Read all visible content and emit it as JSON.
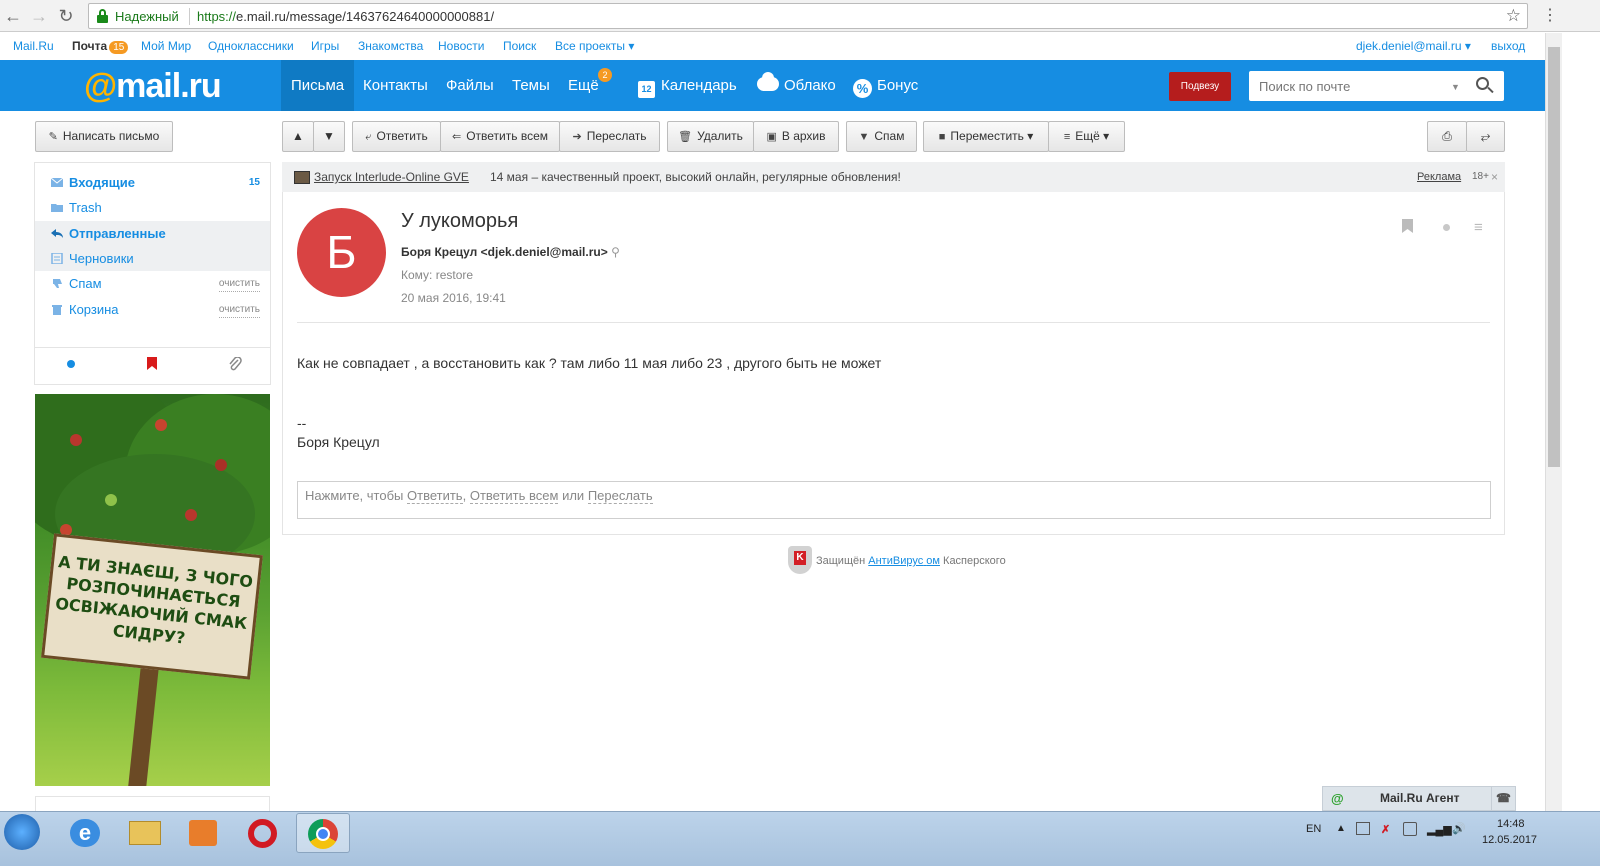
{
  "browser": {
    "secure_label": "Надежный",
    "url_proto": "https://",
    "url_rest": "e.mail.ru/message/14637624640000000881/"
  },
  "portal": {
    "links": [
      "Mail.Ru",
      "Почта",
      "Мой Мир",
      "Одноклассники",
      "Игры",
      "Знакомства",
      "Новости",
      "Поиск",
      "Все проекты ▾"
    ],
    "mail_count": "15",
    "user": "djek.deniel@mail.ru ▾",
    "logout": "выход"
  },
  "header": {
    "logo_at": "@",
    "logo_text": "mail.ru",
    "nav": [
      "Письма",
      "Контакты",
      "Файлы",
      "Темы",
      "Ещё"
    ],
    "more_badge": "2",
    "calendar_day": "12",
    "calendar": "Календарь",
    "cloud": "Облако",
    "bonus": "Бонус",
    "promo": "Подвезу",
    "search_placeholder": "Поиск по почте"
  },
  "toolbar": {
    "compose": "Написать письмо",
    "reply": "Ответить",
    "reply_all": "Ответить всем",
    "forward": "Переслать",
    "delete": "Удалить",
    "archive": "В архив",
    "spam": "Спам",
    "move": "Переместить ▾",
    "more": "Ещё ▾"
  },
  "sidebar": {
    "folders": [
      {
        "label": "Входящие",
        "count": "15"
      },
      {
        "label": "Trash"
      },
      {
        "label": "Отправленные"
      },
      {
        "label": "Черновики"
      },
      {
        "label": "Спам",
        "action": "очистить"
      },
      {
        "label": "Корзина",
        "action": "очистить"
      }
    ],
    "banner_text": "А ТИ ЗНАЄШ, З ЧОГО РОЗПОЧИНАЄТЬСЯ ОСВІЖАЮЧИЙ СМАК СИДРУ?"
  },
  "ad": {
    "link": "Запуск Interlude-Online GVE",
    "text": "14 мая – качественный проект, высокий онлайн, регулярные обновления!",
    "label": "Реклама",
    "age": "18+"
  },
  "message": {
    "avatar_letter": "Б",
    "subject": "У лукоморья",
    "from": "Боря Крецул <djek.deniel@mail.ru>",
    "to": "Кому: restore",
    "date": "20 мая 2016, 19:41",
    "body": "Как не совпадает , а восстановить как ? там либо 11 мая либо 23 , другого быть не может",
    "sig_sep": "--",
    "sig_name": "Боря Крецул",
    "reply_prefix": "Нажмите, чтобы",
    "reply_link1": "Ответить",
    "reply_link2": "Ответить всем",
    "reply_mid": "или",
    "reply_link3": "Переслать"
  },
  "protection": {
    "prefix": "Защищён",
    "link": "АнтиВирус",
    "link_suffix": "ом",
    "suffix": "Касперского"
  },
  "agent": {
    "label": "Mail.Ru Агент"
  },
  "taskbar": {
    "lang": "EN",
    "time": "14:48",
    "date": "12.05.2017"
  }
}
